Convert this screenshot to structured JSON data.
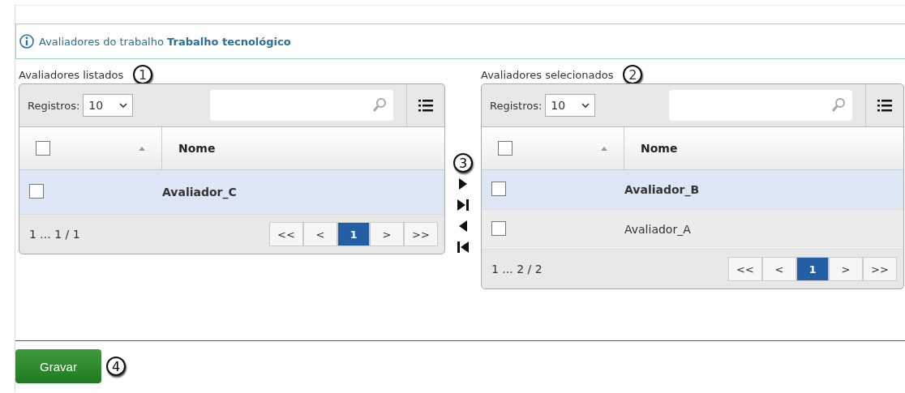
{
  "info": {
    "text": "Avaliadores do trabalho",
    "highlight": "Trabalho tecnológico"
  },
  "panels": [
    {
      "title": "Avaliadores listados",
      "callout": "1",
      "select_all": false,
      "records_label": "Registros:",
      "records_value": "10",
      "column": "Nome",
      "rows": [
        {
          "name": "Avaliador_C",
          "selected": true,
          "checked": false
        }
      ],
      "range": "1 ... 1 / 1",
      "pages": [
        {
          "label": "<<",
          "selected": false
        },
        {
          "label": "<",
          "selected": false
        },
        {
          "label": "1",
          "selected": true
        },
        {
          "label": ">",
          "selected": false
        },
        {
          "label": ">>",
          "selected": false
        }
      ]
    },
    {
      "title": "Avaliadores selecionados",
      "callout": "2",
      "select_all": false,
      "records_label": "Registros:",
      "records_value": "10",
      "column": "Nome",
      "rows": [
        {
          "name": "Avaliador_B",
          "selected": true,
          "checked": false
        },
        {
          "name": "Avaliador_A",
          "selected": false,
          "checked": false
        }
      ],
      "range": "1 ... 2 / 2",
      "pages": [
        {
          "label": "<<",
          "selected": false
        },
        {
          "label": "<",
          "selected": false
        },
        {
          "label": "1",
          "selected": true
        },
        {
          "label": ">",
          "selected": false
        },
        {
          "label": ">>",
          "selected": false
        }
      ]
    }
  ],
  "transfer": {
    "callout": "3",
    "buttons": [
      {
        "kind": "add"
      },
      {
        "kind": "add_all"
      },
      {
        "kind": "remove"
      },
      {
        "kind": "remove_all"
      }
    ]
  },
  "save": {
    "label": "Gravar",
    "callout": "4"
  }
}
